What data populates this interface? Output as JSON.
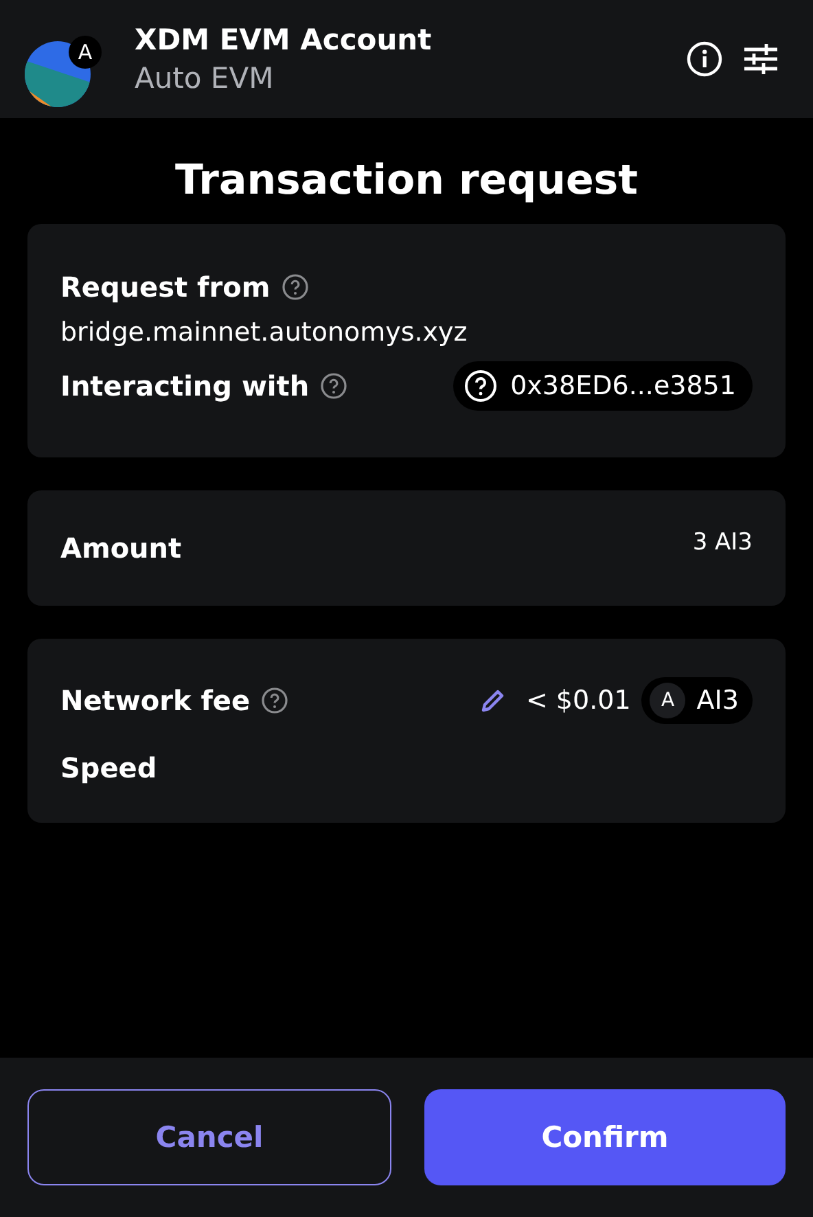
{
  "header": {
    "account_name": "XDM EVM Account",
    "network": "Auto EVM",
    "avatar_badge": "A"
  },
  "title": "Transaction request",
  "request": {
    "from_label": "Request from",
    "origin": "bridge.mainnet.autonomys.xyz",
    "interacting_label": "Interacting with",
    "contract": "0x38ED6...e3851"
  },
  "amount": {
    "label": "Amount",
    "value": "3 AI3"
  },
  "fee": {
    "label": "Network fee",
    "value": "< $0.01",
    "token_badge": "A",
    "token": "AI3",
    "speed_label": "Speed"
  },
  "buttons": [
    {
      "label": "Cancel",
      "kind": "secondary"
    },
    {
      "label": "Confirm",
      "kind": "primary"
    }
  ]
}
